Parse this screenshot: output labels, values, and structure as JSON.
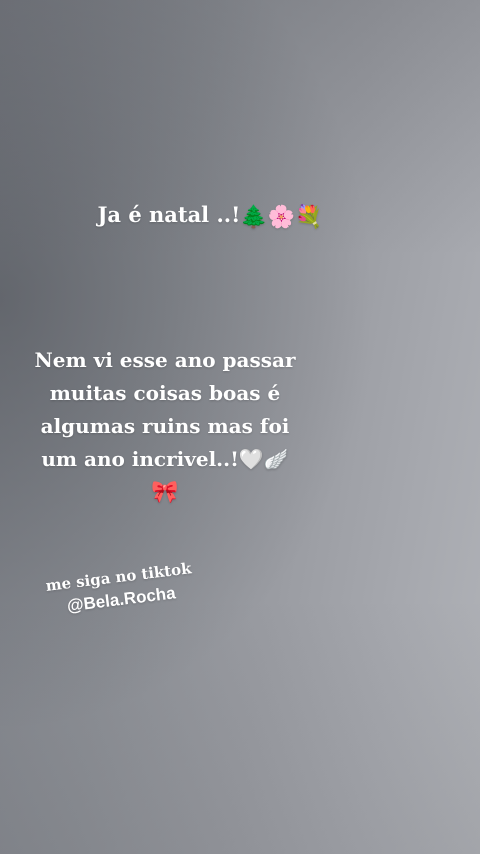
{
  "story": {
    "title": {
      "text": "Ja é natal ..!",
      "emojis": [
        "🌲",
        "🌸",
        "💐"
      ]
    },
    "message": {
      "lines": [
        "Nem vi esse ano passar",
        "muitas coisas boas é",
        "algumas ruins mas foi",
        "um ano incrivel..!🤍🪽",
        "🎀"
      ]
    },
    "follow": {
      "line1": "me siga no tiktok",
      "line2": "@Bela.Rocha"
    }
  }
}
